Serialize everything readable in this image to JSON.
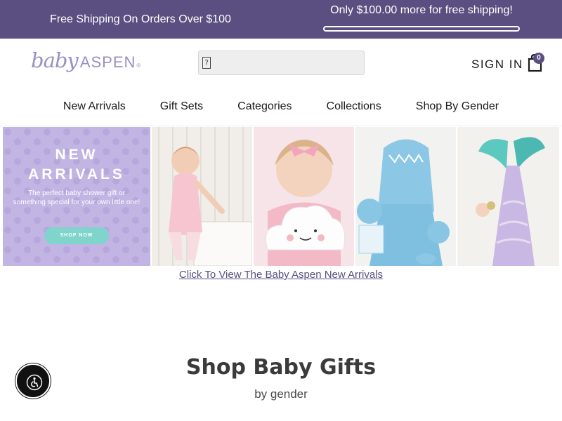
{
  "announcement": {
    "left_text": "Free Shipping On Orders Over $100",
    "right_text": "Only $100.00 more for free shipping!",
    "progress_fraction": 0
  },
  "header": {
    "logo_baby": "baby",
    "logo_aspen": "ASPEN",
    "logo_reg": "®",
    "search": {
      "value": "",
      "placeholder": ""
    },
    "sign_in_label": "SIGN IN",
    "cart_count": "0"
  },
  "nav": {
    "items": [
      {
        "label": "New Arrivals"
      },
      {
        "label": "Gift Sets"
      },
      {
        "label": "Categories"
      },
      {
        "label": "Collections"
      },
      {
        "label": "Shop By Gender"
      }
    ]
  },
  "banner": {
    "title_line1": "NEW",
    "title_line2": "ARRIVALS",
    "subtitle": "The perfect baby shower gift or something special for your own little one!",
    "button_label": "SHOP NOW",
    "link_text": "Click To View The Baby Aspen New Arrivals",
    "photos": [
      "toddler-pink-outfit",
      "girl-with-cloud-bank",
      "shark-hooded-towel-set",
      "mermaid-tail-bank"
    ]
  },
  "section": {
    "title": "Shop Baby Gifts",
    "subtitle": "by gender"
  },
  "colors": {
    "brand_purple": "#5a4f80",
    "logo_lavender": "#9a8fc4",
    "promo_lavender": "#c2b5e4",
    "promo_button": "#7fd4cc"
  },
  "icons": {
    "search": "search-icon",
    "cart": "shopping-bag-icon",
    "accessibility": "accessibility-icon"
  }
}
